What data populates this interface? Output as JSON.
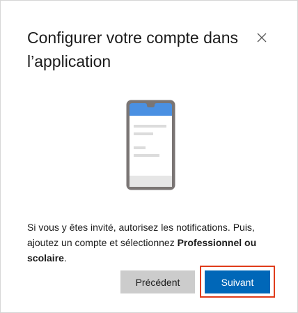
{
  "dialog": {
    "title": "Configurer votre compte dans l’application",
    "close_icon": "close-icon",
    "illustration_icon": "phone-illustration-icon",
    "body": {
      "text_1": "Si vous y êtes invité, autorisez les notifications. Puis, ajoutez un compte et sélectionnez ",
      "text_bold": "Professionnel ou scolaire",
      "text_2": "."
    },
    "buttons": {
      "previous_label": "Précédent",
      "next_label": "Suivant"
    }
  },
  "colors": {
    "accent": "#0067b8",
    "secondary_button": "#cccccc",
    "highlight_border": "#e03c1b",
    "phone_frame": "#7a7574",
    "phone_header": "#4a90e2"
  }
}
